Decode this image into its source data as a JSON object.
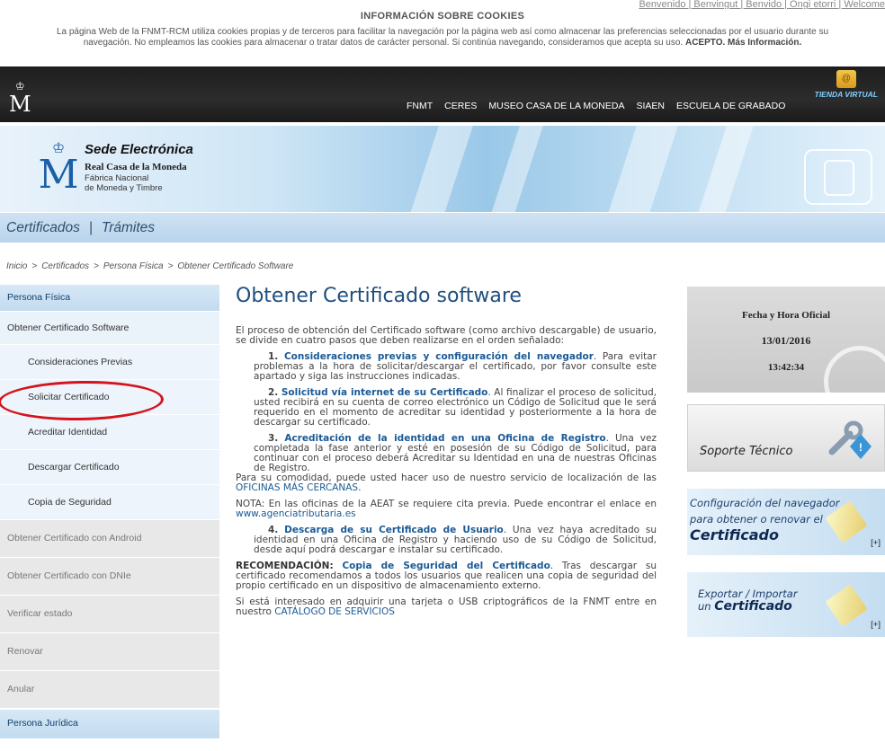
{
  "top_links": "Benvenido | Benvingut | Benvido | Ongi etorri | Welcome",
  "cookies": {
    "title": "INFORMACIÓN SOBRE COOKIES",
    "text_line1": "La página Web de la FNMT-RCM utiliza cookies propias y de terceros para facilitar la navegación por la página web así como almacenar las preferencias seleccionadas por el usuario durante su",
    "text_line2": "navegación. No empleamos las cookies para almacenar o tratar datos de carácter personal. Si continúa navegando, consideramos que acepta su uso.",
    "accept": "ACEPTO.",
    "more": "Más Información."
  },
  "header": {
    "logo": "M",
    "nav": [
      "FNMT",
      "CERES",
      "MUSEO CASA DE LA MONEDA",
      "SIAEN",
      "ESCUELA DE GRABADO"
    ],
    "tienda": "TIENDA VIRTUAL"
  },
  "banner": {
    "title": "Sede Electrónica",
    "subtitle": "Real Casa de la Moneda",
    "line2": "Fábrica Nacional",
    "line3": "de Moneda y Timbre"
  },
  "section_nav": [
    "Certificados",
    "Trámites"
  ],
  "breadcrumb": [
    "Inicio",
    "Certificados",
    "Persona Física",
    "Obtener Certificado Software"
  ],
  "sidebar": {
    "head": "Persona Física",
    "main": "Obtener Certificado Software",
    "subs": [
      "Consideraciones Previas",
      "Solicitar Certificado",
      "Acreditar Identidad",
      "Descargar Certificado",
      "Copia de Seguridad"
    ],
    "others": [
      "Obtener Certificado con Android",
      "Obtener Certificado con DNIe",
      "Verificar estado",
      "Renovar",
      "Anular"
    ],
    "head2": "Persona Jurídica"
  },
  "main": {
    "title": "Obtener Certificado software",
    "intro": "El proceso de obtención del Certificado software (como archivo descargable) de usuario, se divide en cuatro pasos que deben realizarse en el orden señalado:",
    "step1_num": "1.",
    "step1_link": "Consideraciones previas y configuración del navegador",
    "step1_text": ". Para evitar problemas a la hora de solicitar/descargar el certificado, por favor consulte este apartado y siga las instrucciones indicadas.",
    "step2_num": "2.",
    "step2_link": "Solicitud vía internet de su Certificado",
    "step2_text": ". Al finalizar el proceso de solicitud, usted recibirá en su cuenta de correo electrónico un Código de Solicitud que le será requerido en el momento de acreditar su identidad y posteriormente a la hora de descargar su certificado.",
    "step3_num": "3.",
    "step3_link": "Acreditación de la identidad en una Oficina de Registro",
    "step3_text": ". Una vez completada la fase anterior y esté en posesión de su Código de Solicitud, para continuar con el proceso deberá Acreditar su Identidad en una de nuestras Oficinas de Registro.",
    "step3_extra": "Para su comodidad, puede usted hacer uso de nuestro servicio de localización de las",
    "step3_link2": "OFICINAS MÁS CERCANAS",
    "nota": "NOTA: En las oficinas de la AEAT se requiere cita previa. Puede encontrar el enlace en",
    "nota_link": "www.agenciatributaria.es",
    "step4_num": "4.",
    "step4_link": "Descarga de su Certificado de Usuario",
    "step4_text": ". Una vez haya acreditado su identidad en una Oficina de Registro y haciendo uso de su Código de Solicitud, desde aquí podrá descargar e instalar su certificado.",
    "rec_label": "RECOMENDACIÓN:",
    "rec_link": "Copia de Seguridad del Certificado",
    "rec_text": ". Tras descargar su certificado recomendamos a todos los usuarios que realicen una copia de seguridad del propio certificado en un dispositivo de almacenamiento externo.",
    "final": "Si está interesado en adquirir una tarjeta o USB criptográficos de la FNMT entre en nuestro",
    "final_link": "CATÁLOGO DE SERVICIOS"
  },
  "right": {
    "clock_title": "Fecha y Hora Oficial",
    "date": "13/01/2016",
    "time": "13:42:34",
    "soporte": "Soporte Técnico",
    "conf_line1": "Configuración del navegador",
    "conf_line2": "para obtener o renovar el",
    "conf_line3": "Certificado",
    "more": "[+]",
    "expo_line1": "Exportar / Importar",
    "expo_line2_pre": "un ",
    "expo_line2": "Certificado"
  }
}
